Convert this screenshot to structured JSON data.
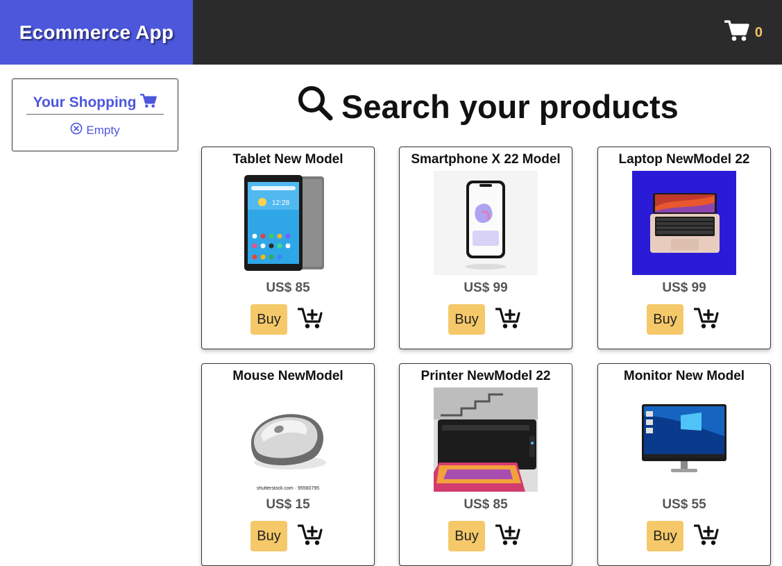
{
  "header": {
    "app_title": "Ecommerce App",
    "cart_count": "0",
    "cart_icon": "cart-icon",
    "colors": {
      "brand": "#4c57dc",
      "bar": "#2b2b2b",
      "count": "#f2c064"
    }
  },
  "sidebar": {
    "heading": "Your Shopping",
    "heading_icon": "cart-icon",
    "status": "Empty",
    "status_icon": "circle-x-icon"
  },
  "main": {
    "search_title": "Search your products",
    "search_icon": "search-icon",
    "buy_label": "Buy",
    "add_icon": "cart-plus-icon",
    "button_color": "#f5c96a",
    "products": [
      {
        "name": "Tablet New Model",
        "price": "US$ 85",
        "image": "tablet"
      },
      {
        "name": "Smartphone X 22 Model",
        "price": "US$ 99",
        "image": "smartphone"
      },
      {
        "name": "Laptop NewModel 22",
        "price": "US$ 99",
        "image": "laptop"
      },
      {
        "name": "Mouse NewModel",
        "price": "US$ 15",
        "image": "mouse",
        "image_caption": "shutterstock.com · 95560795"
      },
      {
        "name": "Printer NewModel 22",
        "price": "US$ 85",
        "image": "printer"
      },
      {
        "name": "Monitor New Model",
        "price": "US$ 55",
        "image": "monitor"
      }
    ]
  }
}
